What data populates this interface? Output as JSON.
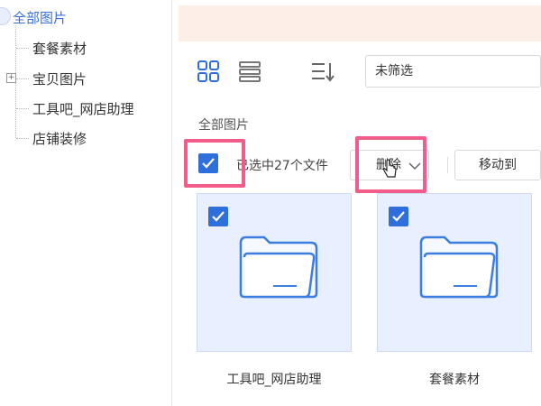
{
  "sidebar": {
    "root_label": "全部图片",
    "items": [
      {
        "label": "套餐素材",
        "has_expander": false
      },
      {
        "label": "宝贝图片",
        "has_expander": true
      },
      {
        "label": "工具吧_网店助理",
        "has_expander": false
      },
      {
        "label": "店铺装修",
        "has_expander": false
      }
    ]
  },
  "toolbar": {
    "filter_value": "未筛选",
    "icons": [
      "grid-view-icon",
      "list-view-icon",
      "sort-icon"
    ]
  },
  "main": {
    "section_title": "全部图片",
    "selection_text": "已选中27个文件",
    "delete_label": "删除",
    "move_label": "移动到"
  },
  "folders": [
    {
      "name": "工具吧_网店助理",
      "checked": true
    },
    {
      "name": "套餐素材",
      "checked": true
    }
  ],
  "colors": {
    "accent": "#2f6fdc",
    "highlight": "#f25c8a",
    "banner": "#fdeee8",
    "card_bg": "#e8efff"
  }
}
